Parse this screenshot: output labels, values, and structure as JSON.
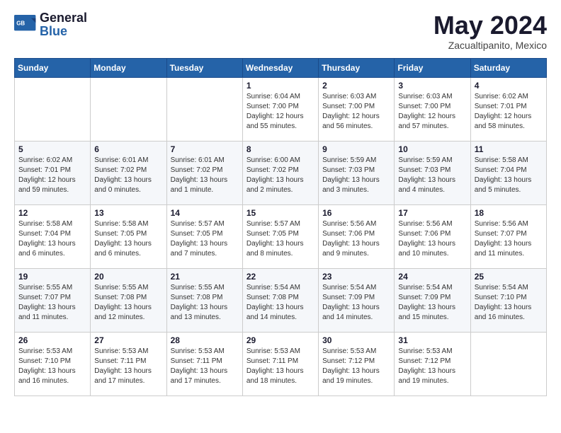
{
  "header": {
    "logo_general": "General",
    "logo_blue": "Blue",
    "month_year": "May 2024",
    "location": "Zacualtipanito, Mexico"
  },
  "days_of_week": [
    "Sunday",
    "Monday",
    "Tuesday",
    "Wednesday",
    "Thursday",
    "Friday",
    "Saturday"
  ],
  "weeks": [
    [
      {
        "day": "",
        "info": ""
      },
      {
        "day": "",
        "info": ""
      },
      {
        "day": "",
        "info": ""
      },
      {
        "day": "1",
        "info": "Sunrise: 6:04 AM\nSunset: 7:00 PM\nDaylight: 12 hours\nand 55 minutes."
      },
      {
        "day": "2",
        "info": "Sunrise: 6:03 AM\nSunset: 7:00 PM\nDaylight: 12 hours\nand 56 minutes."
      },
      {
        "day": "3",
        "info": "Sunrise: 6:03 AM\nSunset: 7:00 PM\nDaylight: 12 hours\nand 57 minutes."
      },
      {
        "day": "4",
        "info": "Sunrise: 6:02 AM\nSunset: 7:01 PM\nDaylight: 12 hours\nand 58 minutes."
      }
    ],
    [
      {
        "day": "5",
        "info": "Sunrise: 6:02 AM\nSunset: 7:01 PM\nDaylight: 12 hours\nand 59 minutes."
      },
      {
        "day": "6",
        "info": "Sunrise: 6:01 AM\nSunset: 7:02 PM\nDaylight: 13 hours\nand 0 minutes."
      },
      {
        "day": "7",
        "info": "Sunrise: 6:01 AM\nSunset: 7:02 PM\nDaylight: 13 hours\nand 1 minute."
      },
      {
        "day": "8",
        "info": "Sunrise: 6:00 AM\nSunset: 7:02 PM\nDaylight: 13 hours\nand 2 minutes."
      },
      {
        "day": "9",
        "info": "Sunrise: 5:59 AM\nSunset: 7:03 PM\nDaylight: 13 hours\nand 3 minutes."
      },
      {
        "day": "10",
        "info": "Sunrise: 5:59 AM\nSunset: 7:03 PM\nDaylight: 13 hours\nand 4 minutes."
      },
      {
        "day": "11",
        "info": "Sunrise: 5:58 AM\nSunset: 7:04 PM\nDaylight: 13 hours\nand 5 minutes."
      }
    ],
    [
      {
        "day": "12",
        "info": "Sunrise: 5:58 AM\nSunset: 7:04 PM\nDaylight: 13 hours\nand 6 minutes."
      },
      {
        "day": "13",
        "info": "Sunrise: 5:58 AM\nSunset: 7:05 PM\nDaylight: 13 hours\nand 6 minutes."
      },
      {
        "day": "14",
        "info": "Sunrise: 5:57 AM\nSunset: 7:05 PM\nDaylight: 13 hours\nand 7 minutes."
      },
      {
        "day": "15",
        "info": "Sunrise: 5:57 AM\nSunset: 7:05 PM\nDaylight: 13 hours\nand 8 minutes."
      },
      {
        "day": "16",
        "info": "Sunrise: 5:56 AM\nSunset: 7:06 PM\nDaylight: 13 hours\nand 9 minutes."
      },
      {
        "day": "17",
        "info": "Sunrise: 5:56 AM\nSunset: 7:06 PM\nDaylight: 13 hours\nand 10 minutes."
      },
      {
        "day": "18",
        "info": "Sunrise: 5:56 AM\nSunset: 7:07 PM\nDaylight: 13 hours\nand 11 minutes."
      }
    ],
    [
      {
        "day": "19",
        "info": "Sunrise: 5:55 AM\nSunset: 7:07 PM\nDaylight: 13 hours\nand 11 minutes."
      },
      {
        "day": "20",
        "info": "Sunrise: 5:55 AM\nSunset: 7:08 PM\nDaylight: 13 hours\nand 12 minutes."
      },
      {
        "day": "21",
        "info": "Sunrise: 5:55 AM\nSunset: 7:08 PM\nDaylight: 13 hours\nand 13 minutes."
      },
      {
        "day": "22",
        "info": "Sunrise: 5:54 AM\nSunset: 7:08 PM\nDaylight: 13 hours\nand 14 minutes."
      },
      {
        "day": "23",
        "info": "Sunrise: 5:54 AM\nSunset: 7:09 PM\nDaylight: 13 hours\nand 14 minutes."
      },
      {
        "day": "24",
        "info": "Sunrise: 5:54 AM\nSunset: 7:09 PM\nDaylight: 13 hours\nand 15 minutes."
      },
      {
        "day": "25",
        "info": "Sunrise: 5:54 AM\nSunset: 7:10 PM\nDaylight: 13 hours\nand 16 minutes."
      }
    ],
    [
      {
        "day": "26",
        "info": "Sunrise: 5:53 AM\nSunset: 7:10 PM\nDaylight: 13 hours\nand 16 minutes."
      },
      {
        "day": "27",
        "info": "Sunrise: 5:53 AM\nSunset: 7:11 PM\nDaylight: 13 hours\nand 17 minutes."
      },
      {
        "day": "28",
        "info": "Sunrise: 5:53 AM\nSunset: 7:11 PM\nDaylight: 13 hours\nand 17 minutes."
      },
      {
        "day": "29",
        "info": "Sunrise: 5:53 AM\nSunset: 7:11 PM\nDaylight: 13 hours\nand 18 minutes."
      },
      {
        "day": "30",
        "info": "Sunrise: 5:53 AM\nSunset: 7:12 PM\nDaylight: 13 hours\nand 19 minutes."
      },
      {
        "day": "31",
        "info": "Sunrise: 5:53 AM\nSunset: 7:12 PM\nDaylight: 13 hours\nand 19 minutes."
      },
      {
        "day": "",
        "info": ""
      }
    ]
  ]
}
